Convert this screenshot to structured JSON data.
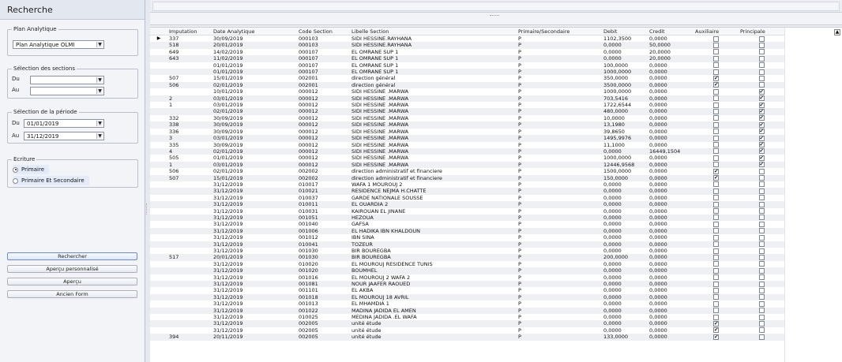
{
  "left": {
    "title": "Recherche",
    "plan_group": {
      "legend": "Plan Analytique",
      "selected": "Plan Analytique OLMI"
    },
    "sections_group": {
      "legend": "Sélection des sections",
      "du_label": "Du",
      "au_label": "Au",
      "du_value": "",
      "au_value": ""
    },
    "period_group": {
      "legend": "Sélection de la période",
      "du_label": "Du",
      "au_label": "Au",
      "du_value": "01/01/2019",
      "au_value": "31/12/2019"
    },
    "ecriture_group": {
      "legend": "Ecriture",
      "options": [
        "Primaire",
        "Primaire Et Secondaire"
      ],
      "selected": 0
    },
    "buttons": {
      "rechercher": "Rechercher",
      "apercu_perso": "Aperçu personnalisé",
      "apercu": "Aperçu",
      "ancien_form": "Ancien Form"
    }
  },
  "grid": {
    "columns": [
      "Imputation",
      "Date Analytique",
      "Code Section",
      "Libelle Section",
      "Primaire/Secondaire",
      "Debit",
      "Credit",
      "Auxiliaire",
      "Principale"
    ],
    "rows": [
      [
        "337",
        "30/09/2019",
        "000103",
        "SIDI HESSINE.RAYHANA",
        "P",
        "1102,3500",
        "0,0000",
        false,
        false
      ],
      [
        "518",
        "20/01/2019",
        "000103",
        "SIDI HESSINE.RAYHANA",
        "P",
        "0,0000",
        "50,0000",
        false,
        false
      ],
      [
        "649",
        "14/02/2019",
        "000107",
        "EL OMRANE SUP 1",
        "P",
        "0,0000",
        "20,0000",
        false,
        false
      ],
      [
        "643",
        "11/02/2019",
        "000107",
        "EL OMRANE SUP 1",
        "P",
        "0,0000",
        "20,0000",
        false,
        false
      ],
      [
        "",
        "01/01/2019",
        "000107",
        "EL OMRANE SUP 1",
        "P",
        "100,0000",
        "0,0000",
        false,
        false
      ],
      [
        "",
        "01/01/2019",
        "000107",
        "EL OMRANE SUP 1",
        "P",
        "1000,0000",
        "0,0000",
        false,
        false
      ],
      [
        "507",
        "15/01/2019",
        "002001",
        "direction général",
        "P",
        "350,0000",
        "0,0000",
        true,
        false
      ],
      [
        "506",
        "02/01/2019",
        "002001",
        "direction général",
        "P",
        "3500,0000",
        "0,0000",
        true,
        false
      ],
      [
        "",
        "10/01/2019",
        "000012",
        "SIDI HESSINE .MARWA",
        "P",
        "1000,0000",
        "0,0000",
        false,
        true
      ],
      [
        "2",
        "03/01/2019",
        "000012",
        "SIDI HESSINE .MARWA",
        "P",
        "703,5416",
        "0,0000",
        false,
        true
      ],
      [
        "1",
        "03/01/2019",
        "000012",
        "SIDI HESSINE .MARWA",
        "P",
        "1722,6544",
        "0,0000",
        false,
        true
      ],
      [
        "",
        "02/01/2019",
        "000012",
        "SIDI HESSINE .MARWA",
        "P",
        "480,0000",
        "0,0000",
        false,
        true
      ],
      [
        "332",
        "30/09/2019",
        "000012",
        "SIDI HESSINE .MARWA",
        "P",
        "10,0000",
        "0,0000",
        false,
        true
      ],
      [
        "338",
        "30/09/2019",
        "000012",
        "SIDI HESSINE .MARWA",
        "P",
        "13,1980",
        "0,0000",
        false,
        true
      ],
      [
        "336",
        "30/09/2019",
        "000012",
        "SIDI HESSINE .MARWA",
        "P",
        "39,8650",
        "0,0000",
        false,
        true
      ],
      [
        "3",
        "03/01/2019",
        "000012",
        "SIDI HESSINE .MARWA",
        "P",
        "1495,9976",
        "0,0000",
        false,
        true
      ],
      [
        "335",
        "30/09/2019",
        "000012",
        "SIDI HESSINE .MARWA",
        "P",
        "11,1000",
        "0,0000",
        false,
        true
      ],
      [
        "4",
        "02/01/2019",
        "000012",
        "SIDI HESSINE .MARWA",
        "P",
        "0,0000",
        "16449,1504",
        false,
        true
      ],
      [
        "505",
        "01/01/2019",
        "000012",
        "SIDI HESSINE .MARWA",
        "P",
        "1000,0000",
        "0,0000",
        false,
        true
      ],
      [
        "1",
        "03/01/2019",
        "000012",
        "SIDI HESSINE .MARWA",
        "P",
        "12446,9568",
        "0,0000",
        false,
        true
      ],
      [
        "506",
        "02/01/2019",
        "002002",
        "direction administratif et financiere",
        "P",
        "1500,0000",
        "0,0000",
        true,
        false
      ],
      [
        "507",
        "15/01/2019",
        "002002",
        "direction administratif et financiere",
        "P",
        "150,0000",
        "0,0000",
        true,
        false
      ],
      [
        "",
        "31/12/2019",
        "010017",
        "WAFA 1 MOUROUJ 2",
        "P",
        "0,0000",
        "0,0000",
        false,
        false
      ],
      [
        "",
        "31/12/2019",
        "010021",
        "RESIDENCE NEJMA H.CHATTE",
        "P",
        "0,0000",
        "0,0000",
        false,
        false
      ],
      [
        "",
        "31/12/2019",
        "010037",
        "GARDE NATIONALE SOUSSE",
        "P",
        "0,0000",
        "0,0000",
        false,
        false
      ],
      [
        "",
        "31/12/2019",
        "010011",
        "EL OUARDIA 2",
        "P",
        "0,0000",
        "0,0000",
        false,
        false
      ],
      [
        "",
        "31/12/2019",
        "010031",
        "KAIROUAN EL JINANE",
        "P",
        "0,0000",
        "0,0000",
        false,
        false
      ],
      [
        "",
        "31/12/2019",
        "001051",
        "HEZOUA",
        "P",
        "0,0000",
        "0,0000",
        false,
        false
      ],
      [
        "",
        "31/12/2019",
        "001040",
        "GAFSA",
        "P",
        "0,0000",
        "0,0000",
        false,
        false
      ],
      [
        "",
        "31/12/2019",
        "001006",
        "EL HADIKA IBN KHALDOUN",
        "P",
        "0,0000",
        "0,0000",
        false,
        false
      ],
      [
        "",
        "31/12/2019",
        "001012",
        "IBN SINA",
        "P",
        "0,0000",
        "0,0000",
        false,
        false
      ],
      [
        "",
        "31/12/2019",
        "010041",
        "TOZEUR",
        "P",
        "0,0000",
        "0,0000",
        false,
        false
      ],
      [
        "",
        "31/12/2019",
        "001030",
        "BIR BOUREGBA",
        "P",
        "0,0000",
        "0,0000",
        false,
        false
      ],
      [
        "517",
        "20/01/2019",
        "001030",
        "BIR BOUREGBA",
        "P",
        "200,0000",
        "0,0000",
        false,
        false
      ],
      [
        "",
        "31/12/2019",
        "010020",
        "EL MOUROUJ RESIDENCE TUNIS",
        "P",
        "0,0000",
        "0,0000",
        false,
        false
      ],
      [
        "",
        "31/12/2019",
        "001020",
        "BOUMHEL",
        "P",
        "0,0000",
        "0,0000",
        false,
        false
      ],
      [
        "",
        "31/12/2019",
        "001016",
        "EL MOUROUJ 2 WAFA 2",
        "P",
        "0,0000",
        "0,0000",
        false,
        false
      ],
      [
        "",
        "31/12/2019",
        "001081",
        "NOUR JAAFER RAOUED",
        "P",
        "0,0000",
        "0,0000",
        false,
        false
      ],
      [
        "",
        "31/12/2019",
        "001101",
        "EL AKBA",
        "P",
        "0,0000",
        "0,0000",
        false,
        false
      ],
      [
        "",
        "31/12/2019",
        "001018",
        "EL MOUROUJ 18 AVRIL",
        "P",
        "0,0000",
        "0,0000",
        false,
        false
      ],
      [
        "",
        "31/12/2019",
        "001013",
        "EL MHAMDIA 1",
        "P",
        "0,0000",
        "0,0000",
        false,
        false
      ],
      [
        "",
        "31/12/2019",
        "001022",
        "MADINA JADIDA EL AMEN",
        "P",
        "0,0000",
        "0,0000",
        false,
        false
      ],
      [
        "",
        "31/12/2019",
        "010025",
        "MEDINA JADIDA .EL WAFA",
        "P",
        "0,0000",
        "0,0000",
        false,
        false
      ],
      [
        "",
        "31/12/2019",
        "002005",
        "unité étude",
        "P",
        "0,0000",
        "0,0000",
        true,
        false
      ],
      [
        "",
        "31/12/2019",
        "002005",
        "unité étude",
        "P",
        "0,0000",
        "0,0000",
        true,
        false
      ],
      [
        "394",
        "20/11/2019",
        "002005",
        "unité étude",
        "P",
        "133,0000",
        "0,0000",
        true,
        false
      ]
    ]
  }
}
